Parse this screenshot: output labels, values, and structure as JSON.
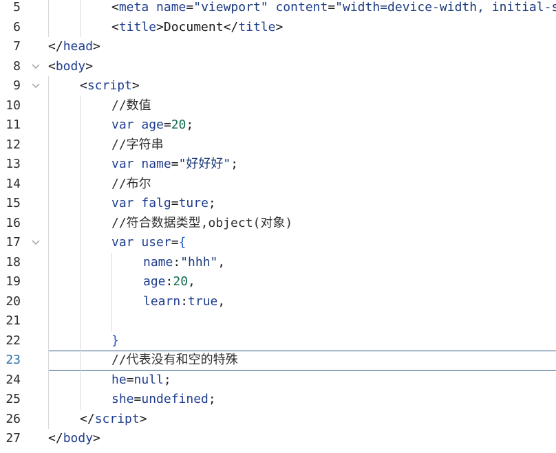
{
  "editor": {
    "colors": {
      "tag": "#1f3d8f",
      "number": "#0f6b4f",
      "brace": "#1f57c9",
      "current_line_number": "#2a6fb0",
      "current_line_border": "#1f4e79",
      "guide": "#d9d9d9"
    },
    "current_line": 23,
    "lines": [
      {
        "n": "5",
        "indent": 2,
        "fold": false,
        "tokens": [
          {
            "t": "<",
            "c": "punct"
          },
          {
            "t": "meta",
            "c": "tag"
          },
          {
            "t": " ",
            "c": "plain"
          },
          {
            "t": "name",
            "c": "attr"
          },
          {
            "t": "=",
            "c": "punct"
          },
          {
            "t": "\"viewport\"",
            "c": "str"
          },
          {
            "t": " ",
            "c": "plain"
          },
          {
            "t": "content",
            "c": "attr"
          },
          {
            "t": "=",
            "c": "punct"
          },
          {
            "t": "\"width=device-width, initial-s",
            "c": "str"
          }
        ]
      },
      {
        "n": "6",
        "indent": 2,
        "fold": false,
        "tokens": [
          {
            "t": "<",
            "c": "punct"
          },
          {
            "t": "title",
            "c": "tag"
          },
          {
            "t": ">",
            "c": "punct"
          },
          {
            "t": "Document",
            "c": "plain"
          },
          {
            "t": "</",
            "c": "punct"
          },
          {
            "t": "title",
            "c": "tag"
          },
          {
            "t": ">",
            "c": "punct"
          }
        ]
      },
      {
        "n": "7",
        "indent": 0,
        "fold": false,
        "tokens": [
          {
            "t": "</",
            "c": "punct"
          },
          {
            "t": "head",
            "c": "tag"
          },
          {
            "t": ">",
            "c": "punct"
          }
        ]
      },
      {
        "n": "8",
        "indent": 0,
        "fold": true,
        "tokens": [
          {
            "t": "<",
            "c": "punct"
          },
          {
            "t": "body",
            "c": "tag"
          },
          {
            "t": ">",
            "c": "punct"
          }
        ]
      },
      {
        "n": "9",
        "indent": 1,
        "fold": true,
        "tokens": [
          {
            "t": "<",
            "c": "punct"
          },
          {
            "t": "script",
            "c": "tag"
          },
          {
            "t": ">",
            "c": "punct"
          }
        ]
      },
      {
        "n": "10",
        "indent": 2,
        "fold": false,
        "tokens": [
          {
            "t": "//数值",
            "c": "comment"
          }
        ]
      },
      {
        "n": "11",
        "indent": 2,
        "fold": false,
        "tokens": [
          {
            "t": "var",
            "c": "keyword"
          },
          {
            "t": " ",
            "c": "plain"
          },
          {
            "t": "age",
            "c": "ident"
          },
          {
            "t": "=",
            "c": "punct"
          },
          {
            "t": "20",
            "c": "number"
          },
          {
            "t": ";",
            "c": "punct"
          }
        ]
      },
      {
        "n": "12",
        "indent": 2,
        "fold": false,
        "tokens": [
          {
            "t": "//字符串",
            "c": "comment"
          }
        ]
      },
      {
        "n": "13",
        "indent": 2,
        "fold": false,
        "tokens": [
          {
            "t": "var",
            "c": "keyword"
          },
          {
            "t": " ",
            "c": "plain"
          },
          {
            "t": "name",
            "c": "ident"
          },
          {
            "t": "=",
            "c": "punct"
          },
          {
            "t": "\"好好好\"",
            "c": "str"
          },
          {
            "t": ";",
            "c": "punct"
          }
        ]
      },
      {
        "n": "14",
        "indent": 2,
        "fold": false,
        "tokens": [
          {
            "t": "//布尔",
            "c": "comment"
          }
        ]
      },
      {
        "n": "15",
        "indent": 2,
        "fold": false,
        "tokens": [
          {
            "t": "var",
            "c": "keyword"
          },
          {
            "t": " ",
            "c": "plain"
          },
          {
            "t": "falg",
            "c": "ident"
          },
          {
            "t": "=",
            "c": "punct"
          },
          {
            "t": "ture",
            "c": "ident"
          },
          {
            "t": ";",
            "c": "punct"
          }
        ]
      },
      {
        "n": "16",
        "indent": 2,
        "fold": false,
        "tokens": [
          {
            "t": "//符合数据类型,object(对象)",
            "c": "comment"
          }
        ]
      },
      {
        "n": "17",
        "indent": 2,
        "fold": true,
        "tokens": [
          {
            "t": "var",
            "c": "keyword"
          },
          {
            "t": " ",
            "c": "plain"
          },
          {
            "t": "user",
            "c": "ident"
          },
          {
            "t": "=",
            "c": "punct"
          },
          {
            "t": "{",
            "c": "brace"
          }
        ]
      },
      {
        "n": "18",
        "indent": 3,
        "fold": false,
        "tokens": [
          {
            "t": "name",
            "c": "ident"
          },
          {
            "t": ":",
            "c": "punct"
          },
          {
            "t": "\"hhh\"",
            "c": "str"
          },
          {
            "t": ",",
            "c": "punct"
          }
        ]
      },
      {
        "n": "19",
        "indent": 3,
        "fold": false,
        "tokens": [
          {
            "t": "age",
            "c": "ident"
          },
          {
            "t": ":",
            "c": "punct"
          },
          {
            "t": "20",
            "c": "number"
          },
          {
            "t": ",",
            "c": "punct"
          }
        ]
      },
      {
        "n": "20",
        "indent": 3,
        "fold": false,
        "tokens": [
          {
            "t": "learn",
            "c": "ident"
          },
          {
            "t": ":",
            "c": "punct"
          },
          {
            "t": "true",
            "c": "ident"
          },
          {
            "t": ",",
            "c": "punct"
          }
        ]
      },
      {
        "n": "21",
        "indent": 3,
        "fold": false,
        "tokens": []
      },
      {
        "n": "22",
        "indent": 2,
        "fold": false,
        "tokens": [
          {
            "t": "}",
            "c": "brace"
          }
        ]
      },
      {
        "n": "23",
        "indent": 2,
        "fold": false,
        "tokens": [
          {
            "t": "//代表没有和空的特殊",
            "c": "comment"
          }
        ]
      },
      {
        "n": "24",
        "indent": 2,
        "fold": false,
        "tokens": [
          {
            "t": "he",
            "c": "ident"
          },
          {
            "t": "=",
            "c": "punct"
          },
          {
            "t": "null",
            "c": "ident"
          },
          {
            "t": ";",
            "c": "punct"
          }
        ]
      },
      {
        "n": "25",
        "indent": 2,
        "fold": false,
        "tokens": [
          {
            "t": "she",
            "c": "ident"
          },
          {
            "t": "=",
            "c": "punct"
          },
          {
            "t": "undefined",
            "c": "ident"
          },
          {
            "t": ";",
            "c": "punct"
          }
        ]
      },
      {
        "n": "26",
        "indent": 1,
        "fold": false,
        "tokens": [
          {
            "t": "</",
            "c": "punct"
          },
          {
            "t": "script",
            "c": "tag"
          },
          {
            "t": ">",
            "c": "punct"
          }
        ]
      },
      {
        "n": "27",
        "indent": 0,
        "fold": false,
        "tokens": [
          {
            "t": "</",
            "c": "punct"
          },
          {
            "t": "body",
            "c": "tag"
          },
          {
            "t": ">",
            "c": "punct"
          }
        ]
      }
    ]
  }
}
